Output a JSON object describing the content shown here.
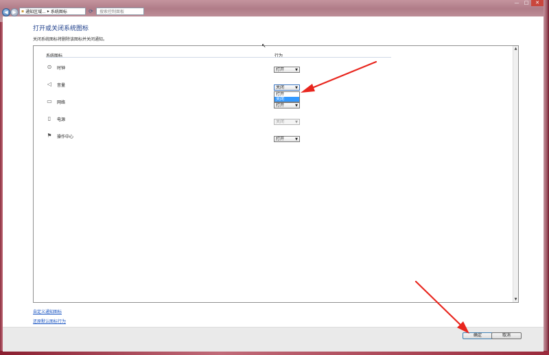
{
  "window": {
    "breadcrumb_1": "通知区域...",
    "breadcrumb_sep": "▸",
    "breadcrumb_2": "系统图标",
    "search_placeholder": "搜索控制面板",
    "controls": [
      "—",
      "□",
      "✕"
    ]
  },
  "page": {
    "title": "打开或关闭系统图标",
    "description": "关闭系统图标将删除该图标并关闭通知。"
  },
  "table": {
    "col_icons": "系统图标",
    "col_behavior": "行为",
    "rows": [
      {
        "label": "时钟",
        "icon": "clock-icon",
        "value": "打开",
        "state": "normal"
      },
      {
        "label": "音量",
        "icon": "speaker-icon",
        "value": "关闭",
        "state": "open"
      },
      {
        "label": "网络",
        "icon": "network-icon",
        "value": "打开",
        "state": "normal"
      },
      {
        "label": "电源",
        "icon": "power-icon",
        "value": "关闭",
        "state": "disabled"
      },
      {
        "label": "操作中心",
        "icon": "action-center-icon",
        "value": "打开",
        "state": "normal"
      }
    ],
    "dropdown_options": [
      "打开",
      "关闭"
    ],
    "dropdown_highlight": "关闭"
  },
  "links": {
    "customize": "自定义通知图标",
    "restore": "还原默认图标行为"
  },
  "buttons": {
    "ok": "确定",
    "cancel": "取消"
  },
  "colors": {
    "title": "#1d3e8a",
    "link": "#1a55c2",
    "highlight": "#3399ff",
    "annotation_arrow": "#e8261e"
  }
}
